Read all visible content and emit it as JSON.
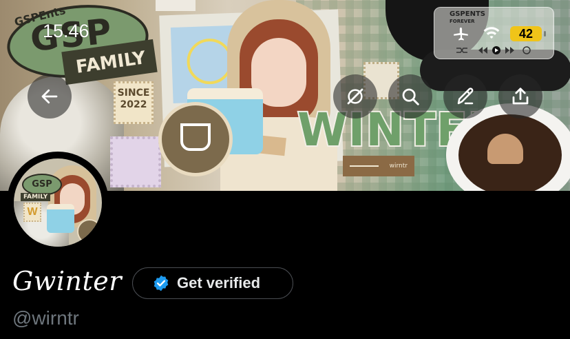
{
  "status_bar": {
    "time": "15.46",
    "battery": "42",
    "widget_brand": "GSPENTS",
    "widget_sub": "FOREVER"
  },
  "banner": {
    "brand_small": "GSPEnts",
    "brand": "GSP",
    "family": "FAMILY",
    "since": "SINCE 2022",
    "headline": "WINTER",
    "handle_tag": "wirntr"
  },
  "actions": {
    "back": "back-arrow-icon",
    "grok": "grok-icon",
    "search": "search-icon",
    "edit": "edit-icon",
    "share": "share-icon"
  },
  "profile": {
    "display_name": "Gwinter",
    "verify_label": "Get verified",
    "handle": "@wirntr",
    "avatar_brand": "GSP",
    "avatar_family": "FAMILY",
    "avatar_letter": "W"
  },
  "colors": {
    "verified_blue": "#1d9bf0",
    "battery_yellow": "#f0c419",
    "handle_gray": "#6e767d",
    "button_border": "#4a4d52"
  }
}
